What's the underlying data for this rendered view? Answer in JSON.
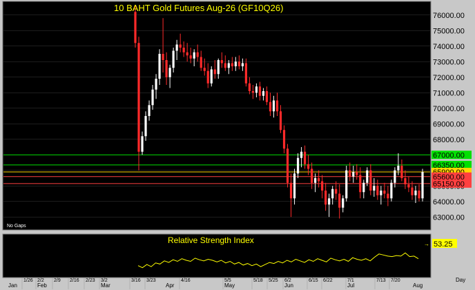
{
  "chart_data": [
    {
      "type": "candlestick",
      "title": "10 BAHT Gold Futures Aug-26 (GF10Q26)",
      "ylim": [
        62300,
        76700
      ],
      "yticks": [
        63000,
        64000,
        65000,
        66000,
        67000,
        68000,
        69000,
        70000,
        71000,
        72000,
        73000,
        74000,
        75000,
        76000
      ],
      "ytick_labels": [
        "63000.00",
        "64000.00",
        "65000.00",
        "66000.00",
        "67000.00",
        "68000.00",
        "69000.00",
        "70000.00",
        "71000.00",
        "72000.00",
        "73000.00",
        "74000.00",
        "75000.00",
        "76000.00"
      ],
      "hlines": [
        {
          "value": 67000,
          "label": "67000.00",
          "color": "#00e000"
        },
        {
          "value": 66350,
          "label": "66350.00",
          "color": "#00e000"
        },
        {
          "value": 65900,
          "label": "65900.00",
          "color": "#ffd700"
        },
        {
          "value": 65600,
          "label": "65600.00",
          "color": "#ff4040"
        },
        {
          "value": 65150,
          "label": "65150.00",
          "color": "#ff4040"
        }
      ],
      "annotation": "No Gaps",
      "candles": [
        [
          76200,
          76600,
          73900,
          74200
        ],
        [
          74200,
          74600,
          66000,
          67200
        ],
        [
          67200,
          68500,
          67000,
          68200
        ],
        [
          68200,
          69800,
          67900,
          69500
        ],
        [
          69500,
          70500,
          69200,
          70200
        ],
        [
          70200,
          71500,
          69900,
          71200
        ],
        [
          71200,
          72200,
          70600,
          71900
        ],
        [
          71900,
          73800,
          71500,
          73500
        ],
        [
          73500,
          75800,
          72300,
          73100
        ],
        [
          73100,
          73600,
          71500,
          72000
        ],
        [
          72000,
          72800,
          71300,
          72600
        ],
        [
          72600,
          73900,
          72300,
          73700
        ],
        [
          73700,
          74400,
          73100,
          74100
        ],
        [
          74100,
          74800,
          73600,
          73900
        ],
        [
          73900,
          74300,
          73300,
          73600
        ],
        [
          73600,
          74200,
          73000,
          73400
        ],
        [
          73400,
          73900,
          72900,
          73200
        ],
        [
          73200,
          73800,
          72700,
          73600
        ],
        [
          73600,
          74100,
          73000,
          73300
        ],
        [
          73300,
          73700,
          72400,
          72600
        ],
        [
          72600,
          73200,
          72100,
          72400
        ],
        [
          72400,
          72900,
          71300,
          71600
        ],
        [
          71600,
          72700,
          71400,
          72500
        ],
        [
          72500,
          73100,
          71900,
          72200
        ],
        [
          72200,
          73200,
          71900,
          73100
        ],
        [
          73100,
          73600,
          72600,
          72900
        ],
        [
          72900,
          73400,
          72400,
          72600
        ],
        [
          72600,
          73100,
          72200,
          72900
        ],
        [
          72900,
          73300,
          72400,
          72700
        ],
        [
          72700,
          73300,
          72400,
          73000
        ],
        [
          73000,
          73400,
          72500,
          72700
        ],
        [
          72700,
          73200,
          72400,
          72900
        ],
        [
          72900,
          73200,
          71400,
          71600
        ],
        [
          71600,
          72000,
          70900,
          71100
        ],
        [
          71100,
          71500,
          70600,
          71000
        ],
        [
          71000,
          71600,
          70700,
          71400
        ],
        [
          71400,
          71700,
          70500,
          70800
        ],
        [
          70800,
          71300,
          70500,
          71100
        ],
        [
          71100,
          71400,
          70200,
          70400
        ],
        [
          70400,
          71000,
          69500,
          69800
        ],
        [
          69800,
          70800,
          69400,
          70500
        ],
        [
          70500,
          71000,
          69500,
          69800
        ],
        [
          69800,
          70200,
          68400,
          68600
        ],
        [
          68600,
          68900,
          67100,
          67400
        ],
        [
          67400,
          67700,
          64900,
          65200
        ],
        [
          65200,
          65800,
          63000,
          64200
        ],
        [
          64200,
          66100,
          63800,
          65800
        ],
        [
          65800,
          67100,
          65500,
          66800
        ],
        [
          66800,
          67500,
          66200,
          67200
        ],
        [
          67200,
          67600,
          66100,
          66400
        ],
        [
          66400,
          67000,
          65700,
          66100
        ],
        [
          66100,
          66500,
          64800,
          65200
        ],
        [
          65200,
          65800,
          64600,
          65500
        ],
        [
          65500,
          66000,
          64900,
          65300
        ],
        [
          65300,
          65700,
          64200,
          64700
        ],
        [
          64700,
          65200,
          63400,
          63800
        ],
        [
          63800,
          64500,
          63000,
          64200
        ],
        [
          64200,
          65000,
          63800,
          64800
        ],
        [
          64800,
          65300,
          64100,
          64500
        ],
        [
          64500,
          65100,
          62900,
          63600
        ],
        [
          63600,
          64400,
          63300,
          64200
        ],
        [
          64200,
          66300,
          64000,
          66000
        ],
        [
          66000,
          66500,
          65300,
          65600
        ],
        [
          65600,
          66300,
          65200,
          65900
        ],
        [
          65900,
          66400,
          65400,
          65700
        ],
        [
          65700,
          66200,
          64200,
          64600
        ],
        [
          64600,
          65400,
          64200,
          65200
        ],
        [
          65200,
          66200,
          65000,
          66000
        ],
        [
          66000,
          66400,
          64400,
          64700
        ],
        [
          64700,
          65500,
          64300,
          65000
        ],
        [
          65000,
          65400,
          64100,
          64400
        ],
        [
          64400,
          65000,
          63800,
          64700
        ],
        [
          64700,
          65200,
          64200,
          64500
        ],
        [
          64500,
          65000,
          63700,
          64200
        ],
        [
          64200,
          65400,
          64000,
          65200
        ],
        [
          65200,
          66200,
          64900,
          66000
        ],
        [
          66000,
          67100,
          65700,
          66300
        ],
        [
          66300,
          66700,
          65300,
          65500
        ],
        [
          65500,
          66000,
          64800,
          65100
        ],
        [
          65100,
          65600,
          64600,
          64900
        ],
        [
          64900,
          65300,
          64100,
          64400
        ],
        [
          64400,
          65000,
          63900,
          64700
        ],
        [
          64700,
          65100,
          64000,
          64200
        ],
        [
          64200,
          66100,
          64000,
          65900
        ]
      ]
    },
    {
      "type": "line",
      "title": "Relative Strength Index",
      "current_label": "53.25",
      "values": [
        40,
        36,
        42,
        38,
        45,
        43,
        49,
        46,
        51,
        48,
        53,
        50,
        48,
        54,
        51,
        49,
        52,
        50,
        47,
        50,
        45,
        48,
        43,
        46,
        41,
        44,
        40,
        43,
        38,
        42,
        46,
        44,
        48,
        45,
        50,
        47,
        52,
        49,
        46,
        51,
        48,
        53,
        50,
        47,
        54,
        51,
        49,
        52,
        48,
        55,
        52,
        50,
        53,
        49,
        56,
        62,
        60,
        58,
        57,
        59,
        58,
        64,
        57,
        58,
        53
      ]
    }
  ],
  "x_axis": {
    "month_labels": [
      "Jan",
      "Feb",
      "Mar",
      "Apr",
      "May",
      "Jun",
      "Jul",
      "Aug"
    ],
    "date_labels": [
      "1/26",
      "2/2",
      "2/9",
      "2/16",
      "2/23",
      "3/2",
      "3/16",
      "3/23",
      "4/16",
      "5/5",
      "5/18",
      "5/25",
      "6/2",
      "6/15",
      "6/22",
      "7/1",
      "7/13",
      "7/20"
    ],
    "period_label": "Day"
  },
  "colors": {
    "background": "#000000",
    "frame": "#c8c8c8",
    "up": "#ffffff",
    "down": "#ff2a2a",
    "text": "#ffff00",
    "grid": "#3a3a3a"
  }
}
